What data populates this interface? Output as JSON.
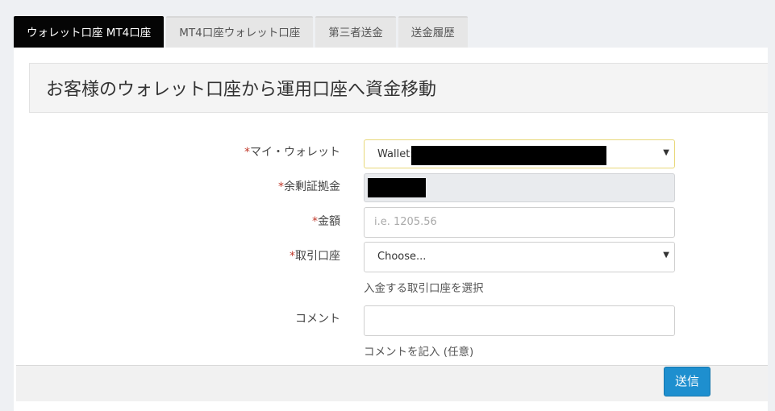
{
  "tabs": [
    {
      "label": "ウォレット口座 MT4口座"
    },
    {
      "label": "MT4口座ウォレット口座"
    },
    {
      "label": "第三者送金"
    },
    {
      "label": "送金履歴"
    }
  ],
  "panel": {
    "title": "お客様のウォレット口座から運用口座へ資金移動"
  },
  "form": {
    "required_mark": "*",
    "wallet": {
      "label": "マイ・ウォレット",
      "value": "Wallet:"
    },
    "balance": {
      "label": "余剰証拠金"
    },
    "amount": {
      "label": "金額",
      "placeholder": "i.e. 1205.56"
    },
    "account": {
      "label": "取引口座",
      "value": "Choose...",
      "help": "入金する取引口座を選択"
    },
    "comment": {
      "label": "コメント",
      "help": "コメントを記入 (任意)"
    }
  },
  "submit_label": "送信",
  "colors": {
    "accent": "#1e8fcf",
    "active_tab": "#050505",
    "required": "#c0392b"
  }
}
